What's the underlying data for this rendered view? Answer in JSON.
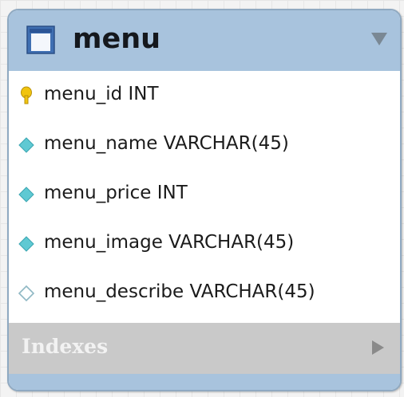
{
  "table": {
    "name": "menu",
    "columns": [
      {
        "text": "menu_id INT",
        "icon": "key-icon"
      },
      {
        "text": "menu_name VARCHAR(45)",
        "icon": "diamond-filled-icon"
      },
      {
        "text": "menu_price INT",
        "icon": "diamond-filled-icon"
      },
      {
        "text": "menu_image VARCHAR(45)",
        "icon": "diamond-filled-icon"
      },
      {
        "text": "menu_describe VARCHAR(45)",
        "icon": "diamond-outline-icon"
      }
    ],
    "indexes_label": "Indexes"
  },
  "colors": {
    "header": "#a8c3dd",
    "border": "#8fa9c1",
    "indexes_bar": "#c9c9c9",
    "key_icon": "#f1c40f",
    "column_icon": "#5fc9d3"
  }
}
